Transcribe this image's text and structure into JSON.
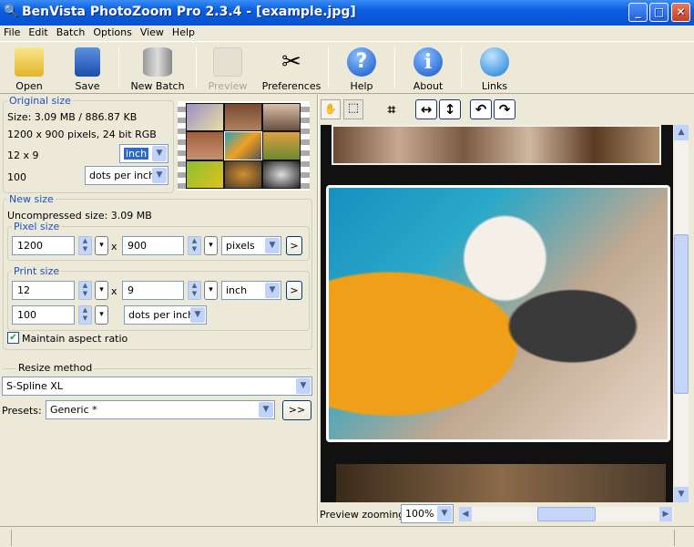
{
  "window": {
    "title": "BenVista PhotoZoom Pro 2.3.4 - [example.jpg]",
    "minimize": "_",
    "maximize": "□",
    "close": "✕"
  },
  "menu": [
    "File",
    "Edit",
    "Batch",
    "Options",
    "View",
    "Help"
  ],
  "toolbar": [
    {
      "label": "Open",
      "icon": "folder-icon"
    },
    {
      "label": "Save",
      "icon": "floppy-icon"
    },
    {
      "label": "New Batch",
      "icon": "database-gear-icon"
    },
    {
      "label": "Preview",
      "icon": "preview-icon",
      "disabled": true
    },
    {
      "label": "Preferences",
      "icon": "tools-icon"
    },
    {
      "label": "Help",
      "icon": "question-icon"
    },
    {
      "label": "About",
      "icon": "info-icon"
    },
    {
      "label": "Links",
      "icon": "globe-icon"
    }
  ],
  "original": {
    "legend": "Original size",
    "size": "Size: 3.09 MB / 886.87 KB",
    "pixels": "1200 x 900 pixels, 24 bit RGB",
    "print": "12 x 9",
    "print_unit": "inch",
    "resolution": "100",
    "res_unit": "dots per inch"
  },
  "new_size": {
    "legend": "New size",
    "uncompressed": "Uncompressed size: 3.09 MB",
    "pixel": {
      "legend": "Pixel size",
      "width": "1200",
      "height": "900",
      "unit": "pixels",
      "x": "x",
      "go": ">"
    },
    "print": {
      "legend": "Print size",
      "width": "12",
      "height": "9",
      "unit": "inch",
      "resolution": "100",
      "res_unit": "dots per inch",
      "x": "x",
      "go": ">"
    },
    "aspect_label": "Maintain aspect ratio",
    "aspect_checked": true
  },
  "resize": {
    "label": "Resize method",
    "method": "S-Spline XL",
    "presets_label": "Presets:",
    "preset": "Generic *",
    "more": ">>"
  },
  "preview": {
    "zoom_label": "Preview zooming:",
    "zoom": "100%"
  }
}
